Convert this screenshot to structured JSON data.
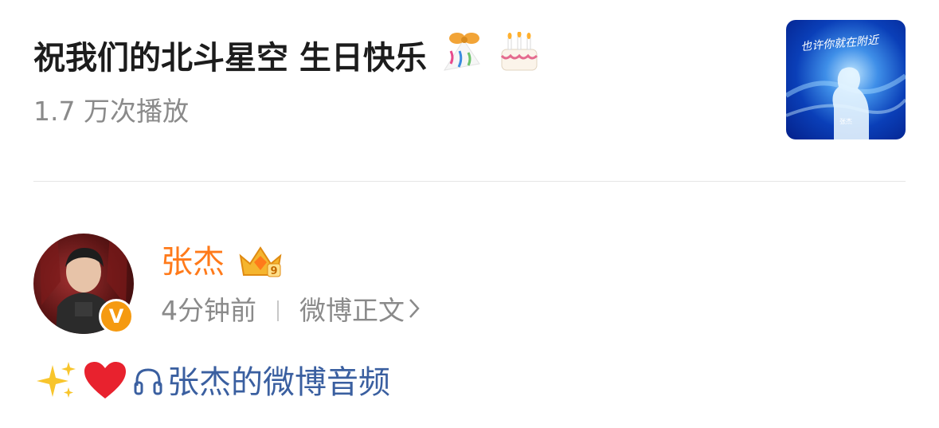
{
  "audio": {
    "title": "祝我们的北斗星空 生日快乐",
    "emoji": [
      "party-popper-icon",
      "birthday-cake-icon"
    ],
    "play_count": "1.7 万次播放",
    "cover": {
      "title": "也许你就在附近",
      "artist": "张杰"
    }
  },
  "author": {
    "name": "张杰",
    "crown_level": "9",
    "verified_badge": "V",
    "time": "4分钟前",
    "source": "微博正文"
  },
  "post": {
    "link_text": "张杰的微博音频",
    "emoji": [
      "sparkles-icon",
      "red-heart-icon",
      "headphones-icon"
    ]
  },
  "colors": {
    "name": "#ff7a1a",
    "link": "#3a5fa0",
    "secondary": "#8a8a8a",
    "verified": "#f59a11"
  }
}
